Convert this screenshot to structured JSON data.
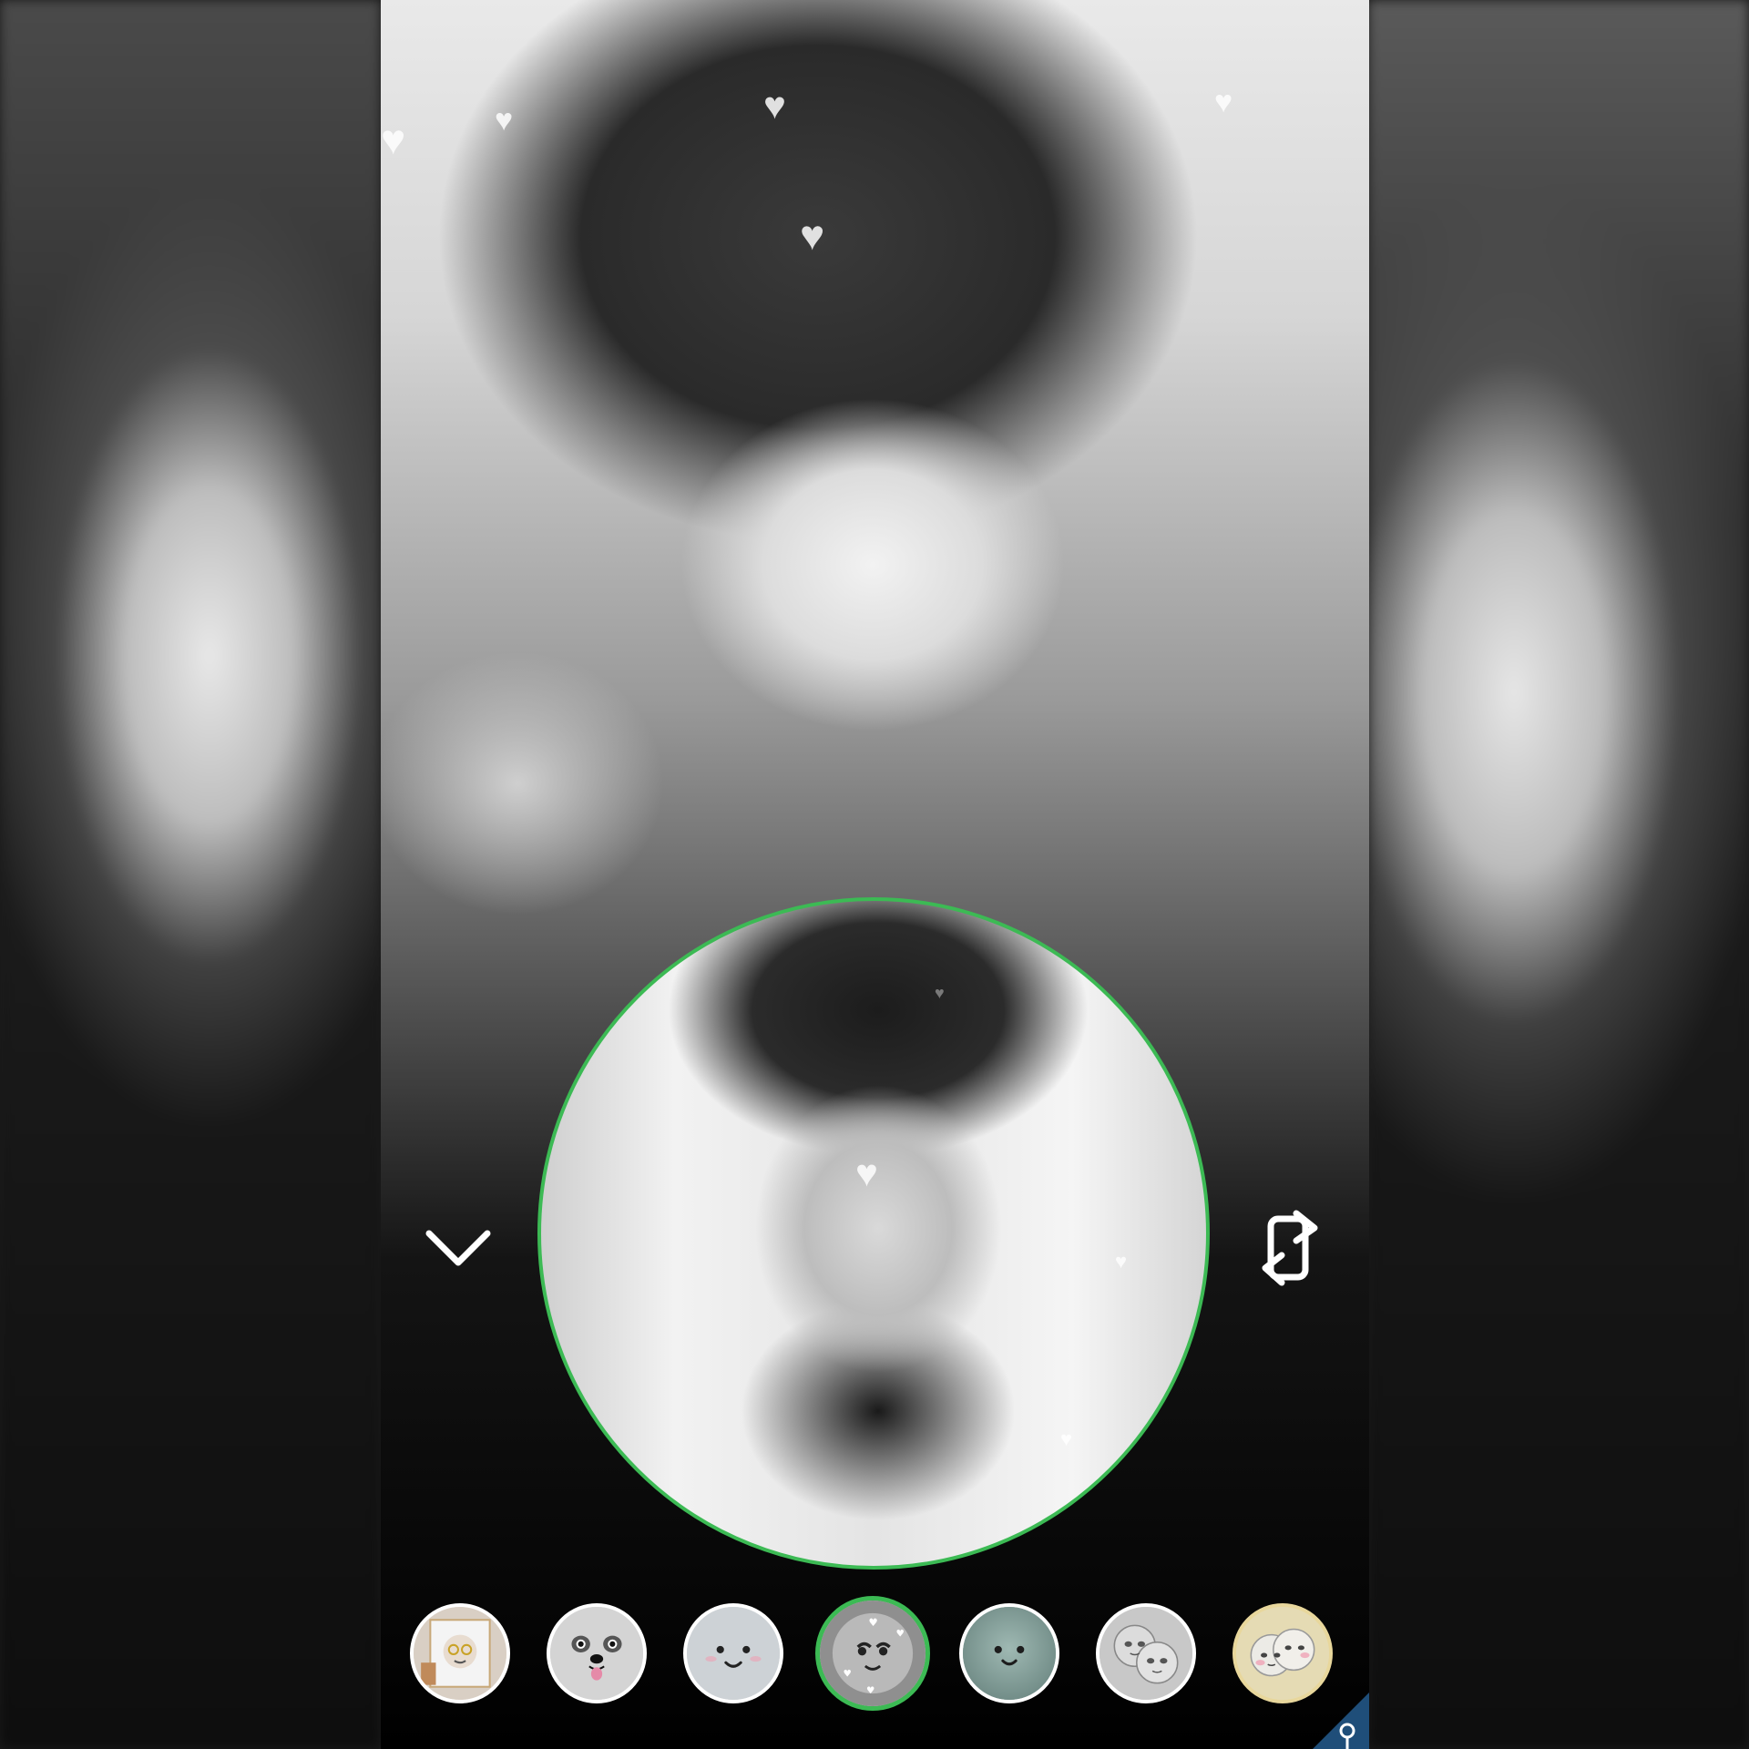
{
  "app": {
    "accent_color": "#3cba54"
  },
  "call": {
    "remote_video": {
      "description_icon": "remote-camera-feed"
    },
    "self_view": {
      "border_color": "#3cba54"
    }
  },
  "controls": {
    "collapse_icon": "chevron-down-icon",
    "flip_camera_icon": "flip-camera-icon"
  },
  "lenses": [
    {
      "name": "lens-1",
      "icon": "selfie-frame-lens",
      "selected": false
    },
    {
      "name": "lens-2",
      "icon": "puppy-face-lens",
      "selected": false
    },
    {
      "name": "lens-3",
      "icon": "cute-face-lens",
      "selected": false
    },
    {
      "name": "lens-4",
      "icon": "heart-face-lens",
      "selected": true
    },
    {
      "name": "lens-5",
      "icon": "teal-face-lens",
      "selected": false
    },
    {
      "name": "lens-6",
      "icon": "couple-face-lens",
      "selected": false
    },
    {
      "name": "lens-7",
      "icon": "blush-couple-lens",
      "selected": false
    }
  ],
  "badge": {
    "icon": "key-icon",
    "color": "#1f4e79"
  }
}
